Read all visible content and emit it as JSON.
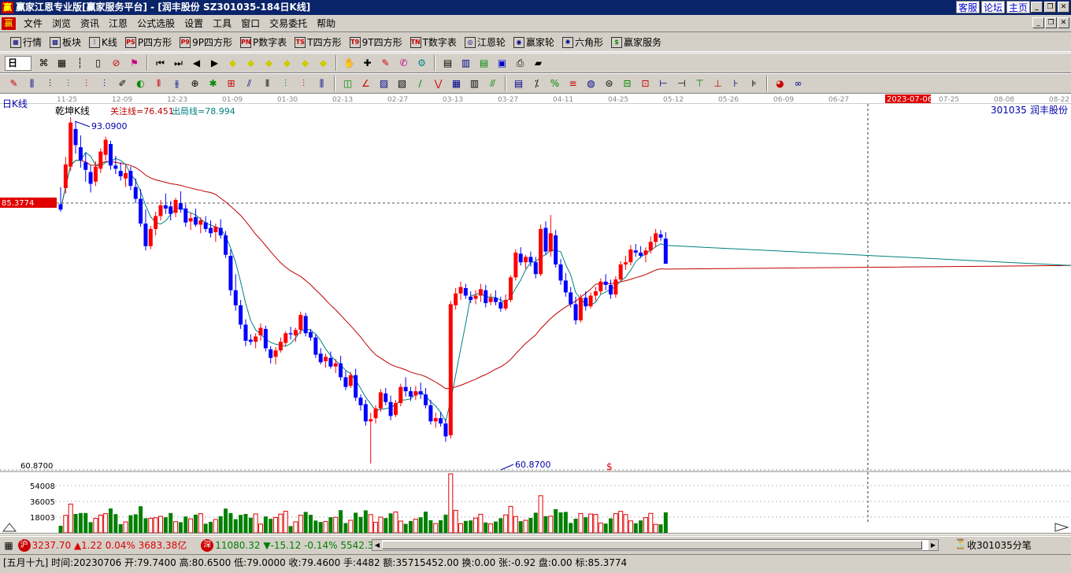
{
  "window": {
    "title": "赢家江恩专业版[赢家服务平台] - [润丰股份   SZ301035-184日K线]",
    "app_icon": "赢",
    "links": [
      "客服",
      "论坛",
      "主页"
    ]
  },
  "menu": [
    "文件",
    "浏览",
    "资讯",
    "江恩",
    "公式选股",
    "设置",
    "工具",
    "窗口",
    "交易委托",
    "帮助"
  ],
  "toolbar1": [
    {
      "label": "行情",
      "icon": "grid-icon"
    },
    {
      "label": "板块",
      "icon": "blocks-icon"
    },
    {
      "label": "K线",
      "icon": "candle-icon"
    },
    {
      "label": "P四方形",
      "icon": "P",
      "ico": "PS"
    },
    {
      "label": "9P四方形",
      "icon": "9P",
      "ico": "P9"
    },
    {
      "label": "P数字表",
      "icon": "PN",
      "ico": "PN"
    },
    {
      "label": "T四方形",
      "icon": "TS",
      "ico": "TS"
    },
    {
      "label": "9T四方形",
      "icon": "T9",
      "ico": "T9"
    },
    {
      "label": "T数字表",
      "icon": "TN",
      "ico": "TN"
    },
    {
      "label": "江恩轮",
      "icon": "wheel-icon"
    },
    {
      "label": "赢家轮",
      "icon": "wheel2-icon"
    },
    {
      "label": "六角形",
      "icon": "hexagon-icon"
    },
    {
      "label": "赢家服务",
      "icon": "dollar-icon"
    }
  ],
  "period_select": "日",
  "chart": {
    "period_label": "日K线",
    "indicator_name": "乾坤K线",
    "guan_zhu": "关注线=76.451",
    "chu_ju": "出局线=78.994",
    "stock_code": "301035",
    "stock_name": "润丰股份",
    "high_label": "93.0900",
    "low_label": "60.8700",
    "crosshair_price": "85.3774",
    "crosshair_date": "2023-07-06",
    "axis_low": "60.8700",
    "dollar_mark": "$",
    "dates": [
      "11-25",
      "12-09",
      "12-23",
      "01-09",
      "01-30",
      "02-13",
      "02-27",
      "03-13",
      "03-27",
      "04-11",
      "04-25",
      "05-12",
      "05-26",
      "06-09",
      "06-27",
      "2023-07-06",
      "07-25",
      "08-08",
      "08-22"
    ],
    "vol_labels": [
      "54008",
      "36005",
      "18003"
    ],
    "colors": {
      "up": "#ff0000",
      "down": "#0000ff",
      "neutral": "#800080",
      "ma_short": "#008080",
      "ma_long": "#c00000",
      "vol": "#008000"
    }
  },
  "chart_data": {
    "type": "candlestick",
    "title": "",
    "price_range": [
      60.87,
      93.09
    ],
    "candles": [
      [
        85.0,
        86.6,
        84.3,
        84.5
      ],
      [
        86.5,
        89.4,
        86.0,
        88.7
      ],
      [
        88.5,
        93.09,
        88.1,
        92.6
      ],
      [
        92.0,
        92.7,
        89.7,
        90.5
      ],
      [
        90.3,
        91.4,
        88.4,
        89.1
      ],
      [
        88.9,
        89.8,
        87.1,
        88.2
      ],
      [
        88.0,
        88.6,
        86.1,
        86.9
      ],
      [
        87.1,
        89.0,
        86.7,
        88.5
      ],
      [
        88.3,
        90.2,
        87.9,
        89.9
      ],
      [
        89.6,
        91.3,
        89.1,
        91.0
      ],
      [
        90.6,
        90.9,
        88.2,
        88.6
      ],
      [
        88.6,
        89.5,
        87.8,
        88.3
      ],
      [
        88.1,
        88.9,
        87.2,
        87.6
      ],
      [
        87.4,
        88.6,
        86.6,
        87.9
      ],
      [
        88.1,
        88.5,
        86.3,
        86.7
      ],
      [
        86.6,
        87.4,
        85.1,
        85.5
      ],
      [
        85.5,
        86.4,
        82.9,
        83.2
      ],
      [
        83.2,
        84.5,
        80.7,
        81.1
      ],
      [
        81.1,
        83.0,
        80.8,
        82.7
      ],
      [
        82.7,
        84.3,
        82.1,
        83.9
      ],
      [
        83.9,
        85.4,
        83.5,
        84.9
      ],
      [
        84.9,
        86.0,
        84.1,
        84.6
      ],
      [
        84.8,
        85.3,
        83.5,
        84.1
      ],
      [
        84.2,
        85.6,
        83.8,
        85.4
      ],
      [
        85.1,
        86.2,
        84.2,
        84.5
      ],
      [
        84.6,
        85.0,
        82.9,
        83.3
      ],
      [
        83.4,
        84.2,
        82.6,
        83.7
      ],
      [
        83.8,
        84.6,
        82.9,
        83.1
      ],
      [
        83.1,
        83.8,
        82.3,
        83.5
      ],
      [
        83.3,
        83.9,
        82.4,
        82.7
      ],
      [
        82.8,
        83.5,
        81.9,
        82.3
      ],
      [
        82.4,
        83.2,
        81.5,
        82.9
      ],
      [
        82.8,
        83.6,
        81.8,
        82.1
      ],
      [
        82.1,
        82.5,
        80.0,
        80.3
      ],
      [
        80.2,
        80.8,
        76.5,
        77.0
      ],
      [
        77.0,
        78.5,
        75.1,
        75.6
      ],
      [
        75.6,
        76.1,
        73.4,
        73.8
      ],
      [
        73.8,
        74.3,
        71.8,
        72.3
      ],
      [
        72.4,
        72.9,
        71.9,
        72.2
      ],
      [
        72.2,
        73.0,
        71.6,
        72.7
      ],
      [
        72.8,
        73.9,
        72.3,
        73.5
      ],
      [
        73.4,
        73.7,
        71.3,
        71.6
      ],
      [
        71.5,
        71.8,
        70.2,
        70.7
      ],
      [
        70.8,
        71.7,
        70.1,
        71.4
      ],
      [
        71.4,
        72.6,
        71.2,
        72.2
      ],
      [
        72.1,
        73.2,
        71.8,
        73.0
      ],
      [
        73.0,
        73.6,
        72.4,
        72.9
      ],
      [
        72.8,
        73.5,
        72.2,
        73.3
      ],
      [
        73.3,
        75.0,
        72.9,
        74.7
      ],
      [
        74.6,
        74.9,
        72.7,
        73.0
      ],
      [
        73.1,
        73.4,
        72.3,
        72.6
      ],
      [
        72.6,
        72.9,
        70.7,
        71.0
      ],
      [
        71.1,
        71.6,
        70.1,
        70.3
      ],
      [
        70.4,
        71.1,
        69.8,
        70.8
      ],
      [
        70.7,
        71.3,
        69.7,
        69.9
      ],
      [
        69.9,
        70.6,
        69.3,
        70.2
      ],
      [
        70.2,
        70.9,
        68.6,
        68.9
      ],
      [
        68.9,
        69.5,
        67.7,
        68.0
      ],
      [
        68.1,
        69.4,
        67.9,
        69.1
      ],
      [
        69.1,
        69.7,
        66.7,
        67.0
      ],
      [
        67.0,
        67.3,
        65.8,
        66.3
      ],
      [
        66.4,
        66.8,
        64.4,
        64.8
      ],
      [
        64.8,
        65.6,
        60.87,
        65.0
      ],
      [
        65.1,
        66.3,
        64.6,
        66.0
      ],
      [
        66.0,
        67.8,
        65.7,
        67.5
      ],
      [
        67.4,
        67.9,
        66.3,
        66.6
      ],
      [
        66.6,
        67.2,
        64.9,
        65.3
      ],
      [
        65.4,
        66.8,
        65.2,
        66.5
      ],
      [
        66.5,
        68.3,
        66.2,
        68.0
      ],
      [
        68.0,
        68.9,
        67.1,
        67.6
      ],
      [
        67.6,
        68.0,
        66.7,
        67.1
      ],
      [
        67.2,
        68.1,
        66.8,
        67.6
      ],
      [
        67.6,
        68.4,
        66.9,
        67.3
      ],
      [
        67.3,
        67.9,
        66.0,
        66.3
      ],
      [
        66.3,
        66.8,
        64.5,
        64.8
      ],
      [
        64.8,
        65.6,
        64.2,
        65.1
      ],
      [
        65.1,
        65.7,
        64.3,
        64.6
      ],
      [
        64.6,
        65.0,
        62.9,
        63.4
      ],
      [
        63.5,
        76.0,
        63.2,
        75.7
      ],
      [
        75.6,
        77.2,
        75.2,
        76.7
      ],
      [
        76.7,
        77.8,
        76.1,
        77.3
      ],
      [
        77.2,
        77.6,
        76.2,
        76.5
      ],
      [
        76.4,
        76.9,
        75.8,
        76.1
      ],
      [
        76.2,
        77.0,
        75.7,
        76.5
      ],
      [
        76.5,
        77.6,
        75.9,
        77.1
      ],
      [
        77.0,
        77.5,
        75.4,
        75.8
      ],
      [
        75.9,
        76.7,
        75.6,
        76.3
      ],
      [
        76.3,
        77.0,
        75.6,
        75.9
      ],
      [
        75.9,
        76.4,
        75.0,
        75.3
      ],
      [
        75.3,
        76.6,
        75.1,
        76.1
      ],
      [
        76.1,
        78.4,
        75.9,
        78.2
      ],
      [
        78.2,
        80.8,
        77.9,
        80.5
      ],
      [
        80.4,
        81.0,
        79.3,
        79.6
      ],
      [
        79.6,
        80.3,
        79.0,
        80.1
      ],
      [
        80.1,
        80.6,
        79.2,
        79.6
      ],
      [
        79.6,
        80.1,
        78.1,
        78.5
      ],
      [
        78.5,
        83.1,
        78.3,
        82.7
      ],
      [
        82.8,
        83.4,
        80.3,
        80.6
      ],
      [
        80.6,
        84.0,
        80.1,
        82.3
      ],
      [
        82.1,
        82.6,
        79.1,
        79.4
      ],
      [
        79.4,
        79.9,
        77.5,
        77.9
      ],
      [
        77.9,
        78.6,
        76.4,
        76.8
      ],
      [
        76.8,
        77.3,
        75.4,
        75.7
      ],
      [
        75.7,
        76.4,
        73.8,
        74.2
      ],
      [
        74.2,
        76.6,
        74.0,
        76.3
      ],
      [
        76.3,
        76.9,
        75.1,
        75.5
      ],
      [
        75.5,
        76.8,
        75.3,
        76.5
      ],
      [
        76.5,
        77.3,
        76.0,
        76.9
      ],
      [
        76.9,
        78.1,
        76.6,
        77.8
      ],
      [
        77.8,
        78.5,
        77.0,
        77.5
      ],
      [
        77.5,
        78.0,
        76.2,
        76.6
      ],
      [
        76.6,
        78.3,
        76.3,
        78.0
      ],
      [
        78.0,
        79.7,
        77.8,
        79.4
      ],
      [
        79.4,
        80.2,
        78.9,
        79.6
      ],
      [
        79.6,
        81.2,
        79.3,
        80.8
      ],
      [
        80.7,
        81.3,
        80.1,
        80.5
      ],
      [
        80.5,
        81.1,
        80.0,
        80.2
      ],
      [
        80.3,
        81.0,
        79.6,
        80.7
      ],
      [
        80.7,
        82.0,
        80.4,
        81.5
      ],
      [
        81.5,
        82.7,
        81.0,
        82.3
      ],
      [
        82.2,
        82.6,
        81.6,
        81.9
      ],
      [
        81.8,
        82.4,
        79.7,
        79.46
      ]
    ]
  },
  "status": {
    "sh_badge": "沪",
    "sh_text": "3237.70 ▲1.22 0.04% 3683.38亿",
    "sz_badge": "深",
    "sz_text": "11080.32 ▼-15.12 -0.14% 5542.3",
    "ticker_label": "收301035分笔",
    "bottom": "[五月十九] 时间:20230706 开:79.7400 高:80.6500 低:79.0000 收:79.4600 手:4482 额:35715452.00 换:0.00 张:-0.92 盘:0.00 标:85.3774"
  }
}
